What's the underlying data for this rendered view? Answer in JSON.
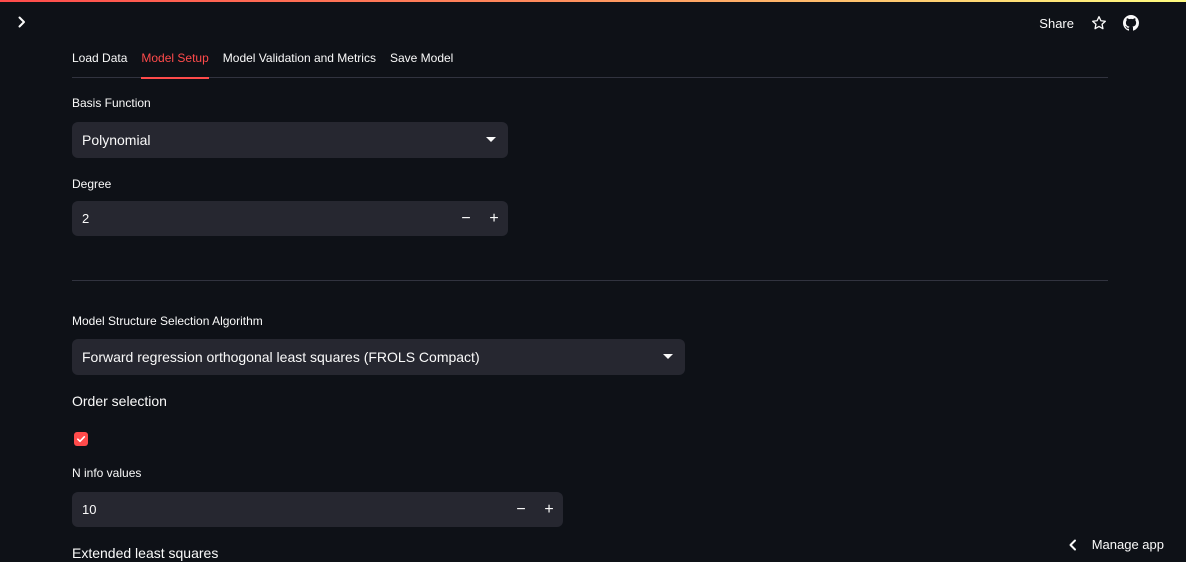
{
  "header": {
    "share_label": "Share",
    "icons": [
      "chevron-right-icon",
      "star-icon",
      "github-icon"
    ]
  },
  "tabs": [
    {
      "label": "Load Data",
      "active": false
    },
    {
      "label": "Model Setup",
      "active": true
    },
    {
      "label": "Model Validation and Metrics",
      "active": false
    },
    {
      "label": "Save Model",
      "active": false
    }
  ],
  "basis": {
    "label": "Basis Function",
    "selected": "Polynomial"
  },
  "degree": {
    "label": "Degree",
    "value": "2",
    "minus": "−",
    "plus": "+"
  },
  "mss": {
    "label": "Model Structure Selection Algorithm",
    "selected": "Forward regression orthogonal least squares (FROLS Compact)"
  },
  "order_selection": {
    "label": "Order selection",
    "checked": true
  },
  "n_info": {
    "label": "N info values",
    "value": "10",
    "minus": "−",
    "plus": "+"
  },
  "extended": {
    "label": "Extended least squares"
  },
  "manage": {
    "label": "Manage app"
  },
  "colors": {
    "background": "#0e1117",
    "accent": "#ff4b4b",
    "input_bg": "#262730"
  }
}
